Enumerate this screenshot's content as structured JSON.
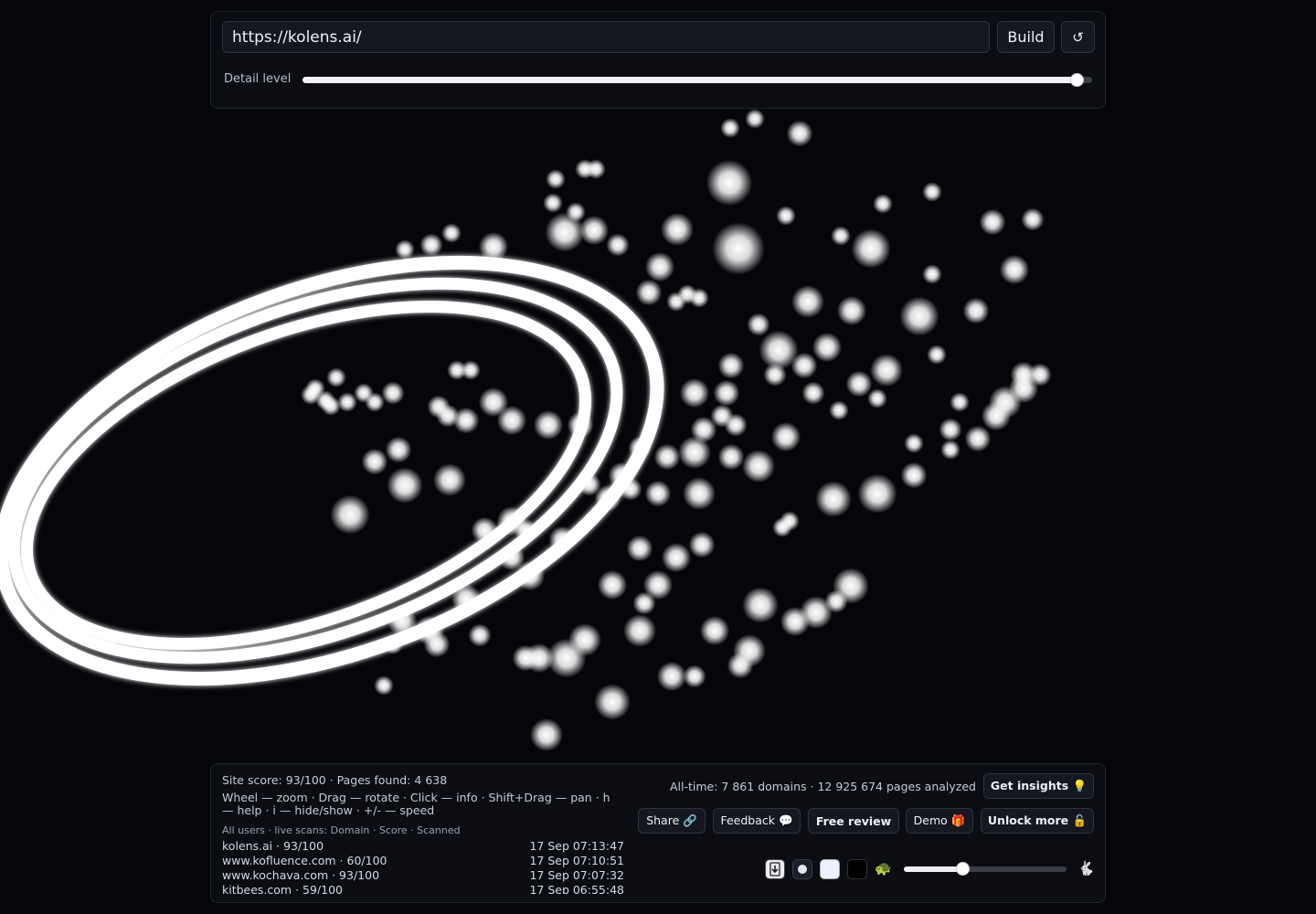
{
  "top": {
    "url_value": "https://kolens.ai/",
    "build_label": "Build",
    "reset_icon": "↺",
    "detail_label": "Detail level",
    "detail_level_fraction": 0.98
  },
  "bottom": {
    "site_stats": "Site score: 93/100 · Pages found: 4 638",
    "help": "Wheel — zoom · Drag — rotate · Click — info · Shift+Drag — pan · h — help · i — hide/show · +/- — speed",
    "scans_header": "All users · live scans: Domain · Score · Scanned",
    "scans": [
      {
        "domain": "kolens.ai · 93/100",
        "time": "17 Sep 07:13:47"
      },
      {
        "domain": "www.kofluence.com · 60/100",
        "time": "17 Sep 07:10:51"
      },
      {
        "domain": "www.kochava.com · 93/100",
        "time": "17 Sep 07:07:32"
      },
      {
        "domain": "kitbees.com · 59/100",
        "time": "17 Sep 06:55:48"
      }
    ],
    "alltime": "All-time: 7 861 domains · 12 925 674 pages analyzed",
    "insights_label": "Get insights 💡",
    "share_label": "Share 🔗",
    "feedback_label": "Feedback 💬",
    "review_label": "Free review",
    "demo_label": "Demo 🎁",
    "unlock_label": "Unlock more 🔓",
    "download_icon": "⭳",
    "turtle_icon": "🐢",
    "rabbit_icon": "🐇",
    "speed_fraction": 0.36
  },
  "colors": {
    "background": "#05060a",
    "node": "#ffffff",
    "panel": "#0b0d13"
  }
}
